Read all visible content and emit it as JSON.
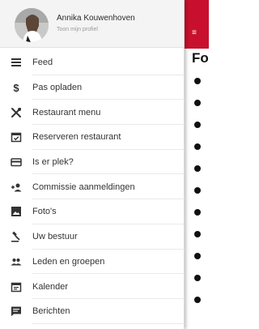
{
  "underlay": {
    "title_fragment": "Fo",
    "menu_glyph": "≡",
    "bullet_count": 11,
    "header_color": "#c8102e"
  },
  "profile": {
    "name": "Annika Kouwenhoven",
    "subtitle": "Toon mijn profiel"
  },
  "menu": {
    "items": [
      {
        "label": "Feed",
        "icon": "feed-icon"
      },
      {
        "label": "Pas opladen",
        "icon": "dollar-icon"
      },
      {
        "label": "Restaurant menu",
        "icon": "fork-knife-icon"
      },
      {
        "label": "Reserveren restaurant",
        "icon": "calendar-check-icon"
      },
      {
        "label": "Is er plek?",
        "icon": "card-icon"
      },
      {
        "label": "Commissie aanmeldingen",
        "icon": "person-add-icon"
      },
      {
        "label": "Foto's",
        "icon": "photo-icon"
      },
      {
        "label": "Uw bestuur",
        "icon": "gavel-icon"
      },
      {
        "label": "Leden en groepen",
        "icon": "people-icon"
      },
      {
        "label": "Kalender",
        "icon": "calendar-icon"
      },
      {
        "label": "Berichten",
        "icon": "chat-icon"
      }
    ]
  }
}
